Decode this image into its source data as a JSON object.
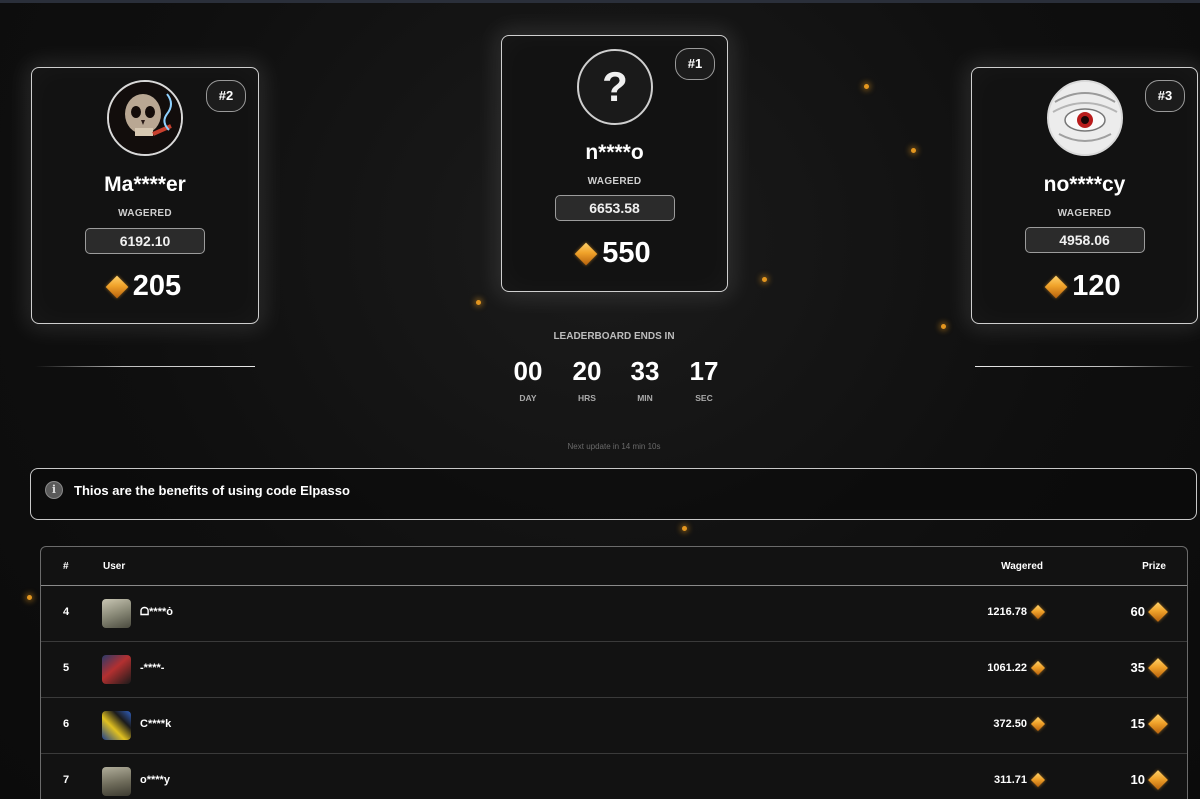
{
  "podium": [
    {
      "rank_badge": "#2",
      "name": "Ma****er",
      "wagered_label": "WAGERED",
      "wagered": "6192.10",
      "prize": "205",
      "avatar": "skull-avatar"
    },
    {
      "rank_badge": "#1",
      "name": "n****o",
      "wagered_label": "WAGERED",
      "wagered": "6653.58",
      "prize": "550",
      "avatar": "question-mark-avatar"
    },
    {
      "rank_badge": "#3",
      "name": "no****cy",
      "wagered_label": "WAGERED",
      "wagered": "4958.06",
      "prize": "120",
      "avatar": "eye-avatar"
    }
  ],
  "countdown": {
    "title": "LEADERBOARD ENDS IN",
    "units": [
      {
        "value": "00",
        "label": "DAY"
      },
      {
        "value": "20",
        "label": "HRS"
      },
      {
        "value": "33",
        "label": "MIN"
      },
      {
        "value": "17",
        "label": "SEC"
      }
    ],
    "next_update": "Next update in 14 min 10s"
  },
  "info": {
    "icon": "info-icon",
    "text": "Thios are the benefits of using code Elpasso"
  },
  "table": {
    "headers": {
      "rank": "#",
      "user": "User",
      "wagered": "Wagered",
      "prize": "Prize"
    },
    "rows": [
      {
        "rank": "4",
        "user": "ᗝ****ȯ",
        "wagered": "1216.78",
        "prize": "60"
      },
      {
        "rank": "5",
        "user": "-****-",
        "wagered": "1061.22",
        "prize": "35"
      },
      {
        "rank": "6",
        "user": "C****k",
        "wagered": "372.50",
        "prize": "15"
      },
      {
        "rank": "7",
        "user": "o****y",
        "wagered": "311.71",
        "prize": "10"
      }
    ]
  },
  "colors": {
    "accent": "#e3961f",
    "card_border": "#cfcfcf",
    "background": "#0d0d0d"
  }
}
